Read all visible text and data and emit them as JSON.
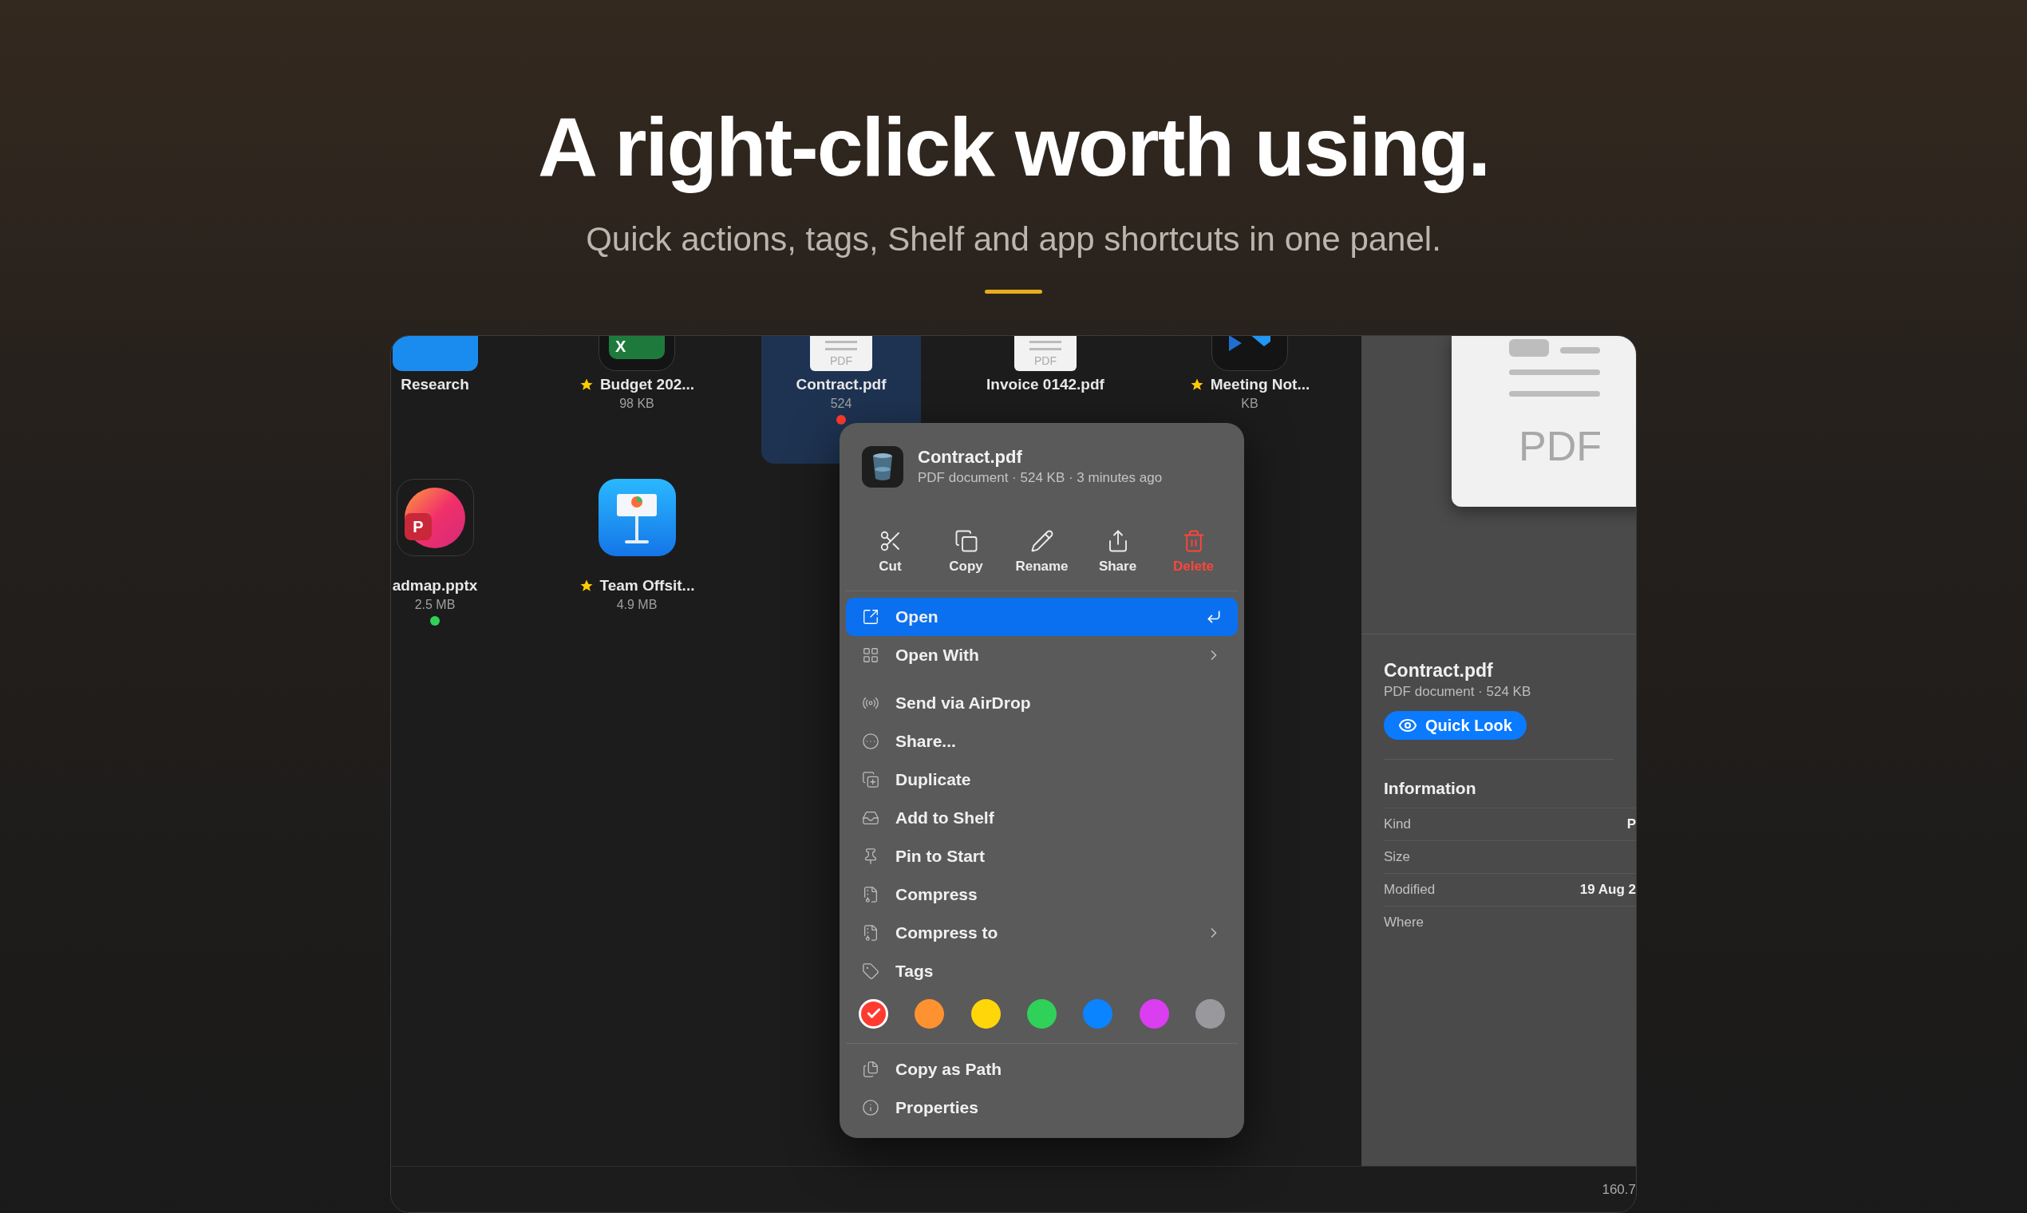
{
  "hero": {
    "title": "A right-click worth using.",
    "subtitle": "Quick actions, tags, Shelf and app shortcuts in one panel."
  },
  "files": [
    [
      {
        "kind": "folder",
        "name": "Research",
        "starred": false
      },
      {
        "kind": "spreadsheet",
        "badge": "X",
        "name": "Budget 202...",
        "size": "98 KB",
        "starred": true
      },
      {
        "kind": "pdf",
        "badge": "PDF",
        "name": "Contract.pdf",
        "size": "524",
        "color": "#ff3b30",
        "selected": true,
        "starred": false
      },
      {
        "kind": "pdf",
        "badge": "PDF",
        "name": "Invoice 0142.pdf",
        "selected": false,
        "starred": false
      },
      {
        "kind": "code",
        "name": "Meeting Not...",
        "size": "KB",
        "starred": true
      }
    ],
    [
      {
        "kind": "slides",
        "badge": "P",
        "name": "admap.pptx",
        "size": "2.5 MB",
        "color": "#30d158",
        "starred": false
      },
      {
        "kind": "keynote",
        "name": "Team Offsit...",
        "size": "4.9 MB",
        "starred": true
      }
    ]
  ],
  "menu": {
    "title": "Contract.pdf",
    "subtitle": "PDF document · 524 KB · 3 minutes ago",
    "quick_actions": [
      {
        "label": "Cut",
        "kind": "normal"
      },
      {
        "label": "Copy",
        "kind": "normal"
      },
      {
        "label": "Rename",
        "kind": "normal"
      },
      {
        "label": "Share",
        "kind": "normal"
      },
      {
        "label": "Delete",
        "kind": "danger"
      }
    ],
    "sections": [
      [
        {
          "label": "Open",
          "selected": true,
          "shortcut": true,
          "submenu": false
        },
        {
          "label": "Open With",
          "selected": false,
          "shortcut": false,
          "submenu": true
        }
      ],
      [
        {
          "label": "Send via AirDrop",
          "selected": false
        },
        {
          "label": "Share...",
          "selected": false
        },
        {
          "label": "Duplicate",
          "selected": false
        },
        {
          "label": "Add to Shelf",
          "selected": false
        },
        {
          "label": "Pin to Start",
          "selected": false
        },
        {
          "label": "Compress",
          "selected": false
        },
        {
          "label": "Compress to",
          "selected": false,
          "submenu": true
        },
        {
          "label": "Tags",
          "selected": false
        }
      ],
      [
        {
          "label": "Copy as Path",
          "selected": false
        },
        {
          "label": "Properties",
          "selected": false
        }
      ]
    ],
    "tags": [
      {
        "color": "#ff3b30",
        "selected": true
      },
      {
        "color": "#ff9230",
        "selected": false
      },
      {
        "color": "#ffd60a",
        "selected": false
      },
      {
        "color": "#30d158",
        "selected": false
      },
      {
        "color": "#0a84ff",
        "selected": false
      },
      {
        "color": "#da3ef0",
        "selected": false
      },
      {
        "color": "#98989d",
        "selected": false
      }
    ]
  },
  "inspector": {
    "preview_label": "PDF",
    "title": "Contract.pdf",
    "subtitle": "PDF document · 524 KB",
    "button": "Quick Look",
    "section": "Information",
    "rows": [
      {
        "label": "Kind",
        "value": "P"
      },
      {
        "label": "Size"
      },
      {
        "label": "Modified",
        "value": "19 Aug 2"
      },
      {
        "label": "Where"
      }
    ]
  },
  "status_bar": {
    "text": "160.7"
  }
}
